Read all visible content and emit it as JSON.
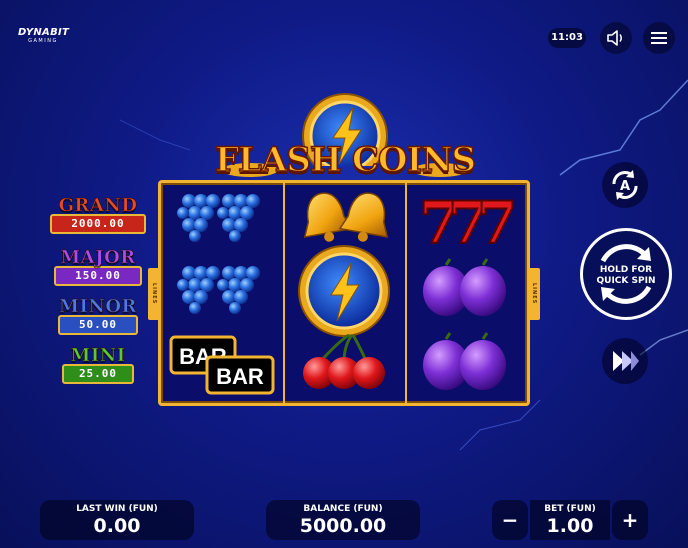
{
  "logo": {
    "line1": "DYNABIT",
    "line2": "GAMING"
  },
  "header": {
    "clock": "11:03",
    "sound_icon": "speaker-icon",
    "menu_icon": "hamburger-menu-icon"
  },
  "game": {
    "title": "FLASH COINS",
    "lines_label": "LINES"
  },
  "jackpots": [
    {
      "name": "GRAND",
      "value": "2000.00",
      "color": "#d33a1f",
      "box": "#c7241a"
    },
    {
      "name": "MAJOR",
      "value": "150.00",
      "color": "#9b3bd8",
      "box": "#7a28c2"
    },
    {
      "name": "MINOR",
      "value": "50.00",
      "color": "#3a63d6",
      "box": "#2a4fc0"
    },
    {
      "name": "MINI",
      "value": "25.00",
      "color": "#4fb527",
      "box": "#2f8d1a"
    }
  ],
  "reels": [
    [
      "grapes",
      "grapes",
      "bar"
    ],
    [
      "bells",
      "flash-coin",
      "cherries"
    ],
    [
      "sevens",
      "plums",
      "plums"
    ]
  ],
  "controls": {
    "spin_label_line1": "HOLD FOR",
    "spin_label_line2": "QUICK SPIN",
    "autoplay_icon": "autoplay-icon",
    "turbo_icon": "fast-forward-icon"
  },
  "footer": {
    "last_win_label": "LAST WIN (FUN)",
    "last_win_value": "0.00",
    "balance_label": "BALANCE (FUN)",
    "balance_value": "5000.00",
    "bet_label": "BET (FUN)",
    "bet_value": "1.00",
    "minus": "−",
    "plus": "+"
  },
  "bar_text": "BAR"
}
